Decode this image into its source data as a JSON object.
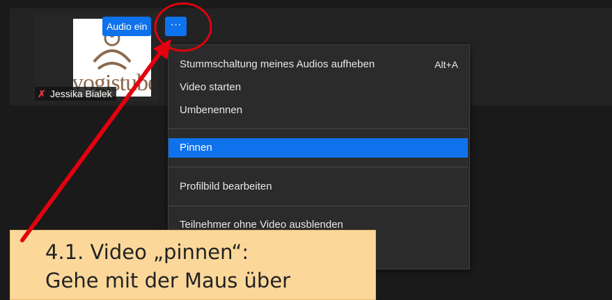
{
  "participant": {
    "name": "Jessika Bialek",
    "logo_text": "yogistube",
    "mic_icon": "mic-muted-icon"
  },
  "toolbar": {
    "audio_on_label": "Audio ein",
    "more_label": "···"
  },
  "menu": {
    "items": [
      {
        "label": "Stummschaltung meines Audios aufheben",
        "shortcut": "Alt+A"
      },
      {
        "label": "Video starten"
      },
      {
        "label": "Umbenennen"
      },
      {
        "label": "Pinnen",
        "highlighted": true
      },
      {
        "label": "Profilbild bearbeiten"
      },
      {
        "label": "Teilnehmer ohne Video ausblenden"
      }
    ]
  },
  "callout": {
    "line1": "4.1. Video „pinnen“:",
    "line2": "Gehe mit der Maus über"
  },
  "colors": {
    "accent": "#0e72ed",
    "annotation": "#e3000f",
    "callout_bg": "#fbd89a"
  }
}
